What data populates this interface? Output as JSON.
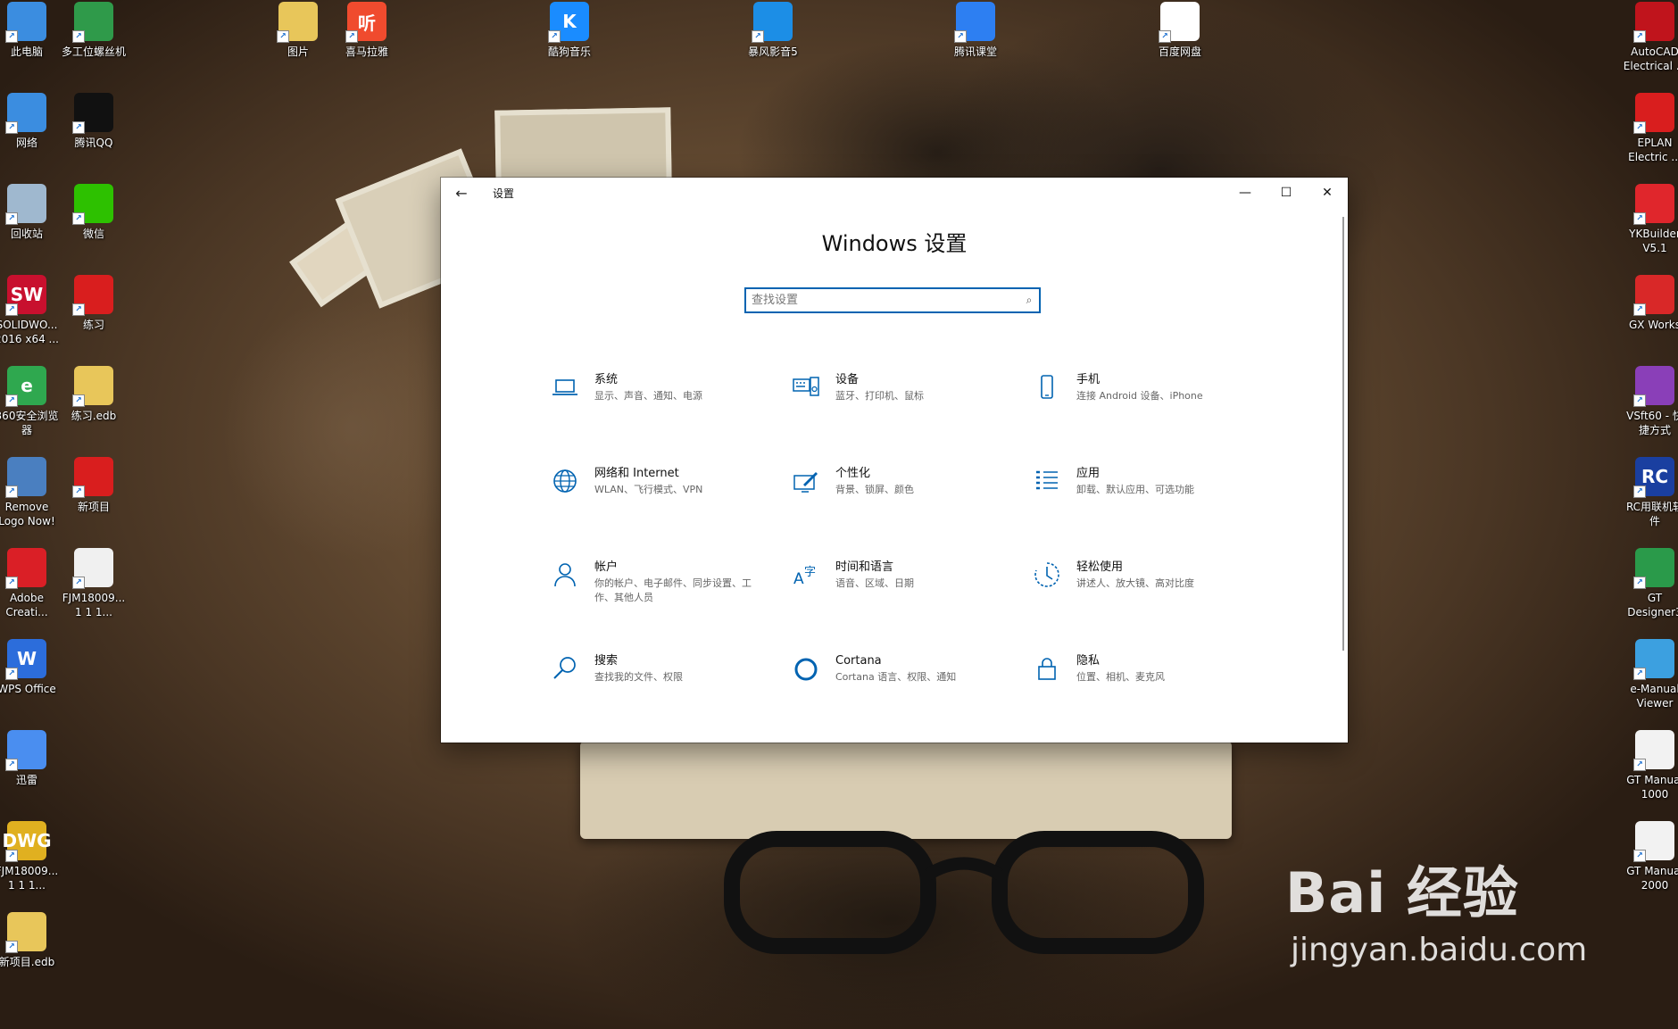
{
  "desktop": {
    "left_icons": [
      {
        "id": "this-pc",
        "label": "此电脑",
        "color": "#3b8de0"
      },
      {
        "id": "network",
        "label": "网络",
        "color": "#3b8de0"
      },
      {
        "id": "recycle-bin",
        "label": "回收站",
        "color": "#9fb8cf"
      },
      {
        "id": "solidworks",
        "label": "SOLIDWO...\n2016 x64 ...",
        "color": "#c8102e",
        "glyph": "SW"
      },
      {
        "id": "360-browser",
        "label": "360安全浏览\n器",
        "color": "#2fa84f",
        "glyph": "e"
      },
      {
        "id": "remove-logo",
        "label": "Remove\nLogo Now!",
        "color": "#4a7fc0"
      },
      {
        "id": "adobe-cc",
        "label": "Adobe\nCreati...",
        "color": "#da1f26"
      },
      {
        "id": "wps-office",
        "label": "WPS Office",
        "color": "#2c6ddb",
        "glyph": "W"
      },
      {
        "id": "xunlei",
        "label": "迅雷",
        "color": "#4a8ef0"
      },
      {
        "id": "dwg-file",
        "label": "FJM18009...\n1  1  1...",
        "color": "#e0b020",
        "glyph": "DWG"
      },
      {
        "id": "new-project-edb",
        "label": "新项目.edb",
        "color": "#e8c65a"
      }
    ],
    "second_icons": [
      {
        "id": "multi-screw",
        "label": "多工位螺丝机",
        "color": "#2f9a4a"
      },
      {
        "id": "tencent-qq",
        "label": "腾讯QQ",
        "color": "#111111"
      },
      {
        "id": "wechat",
        "label": "微信",
        "color": "#2dc100"
      },
      {
        "id": "practice",
        "label": "练习",
        "color": "#d91e1e"
      },
      {
        "id": "practice-edb",
        "label": "练习.edb",
        "color": "#e8c65a"
      },
      {
        "id": "new-project",
        "label": "新项目",
        "color": "#d91e1e"
      },
      {
        "id": "fjm-file",
        "label": "FJM18009...\n1  1  1...",
        "color": "#f0f0f0"
      }
    ],
    "top_icons": [
      {
        "id": "pictures",
        "label": "图片",
        "color": "#e8c65a"
      },
      {
        "id": "ximalaya",
        "label": "喜马拉雅",
        "color": "#f04b2e",
        "glyph": "听"
      },
      {
        "id": "kugou",
        "label": "酷狗音乐",
        "color": "#1a8cff",
        "glyph": "K"
      },
      {
        "id": "baofeng",
        "label": "暴风影音5",
        "color": "#1c8ee6"
      },
      {
        "id": "tencent-classroom",
        "label": "腾讯课堂",
        "color": "#2d7ff2"
      },
      {
        "id": "baidu-netdisk",
        "label": "百度网盘",
        "color": "#ffffff"
      }
    ],
    "right_icons": [
      {
        "id": "autocad-electrical",
        "label": "AutoCAD\nElectrical ...",
        "color": "#c0141c"
      },
      {
        "id": "eplan",
        "label": "EPLAN\nElectric ...",
        "color": "#d91e1e"
      },
      {
        "id": "ykbuilder",
        "label": "YKBuilder\nV5.1",
        "color": "#e0262c"
      },
      {
        "id": "gx-works",
        "label": "GX Works",
        "color": "#d92828"
      },
      {
        "id": "vsft60",
        "label": "VSft60 - 快\n捷方式",
        "color": "#8a3fb8"
      },
      {
        "id": "rc-networking",
        "label": "RC用联机软\n件",
        "color": "#1a3fa0",
        "glyph": "RC"
      },
      {
        "id": "gt-designer",
        "label": "GT\nDesigner3",
        "color": "#2a9a4a"
      },
      {
        "id": "e-manual-viewer",
        "label": "e-Manual\nViewer",
        "color": "#3ca0e0"
      },
      {
        "id": "gt-manual-1000",
        "label": "GT Manual\n1000",
        "color": "#f2f2f2"
      },
      {
        "id": "gt-manual-2000",
        "label": "GT Manual\n2000",
        "color": "#f2f2f2"
      }
    ]
  },
  "window": {
    "title": "设置",
    "back_glyph": "←",
    "min_glyph": "—",
    "max_glyph": "☐",
    "close_glyph": "✕",
    "heading": "Windows 设置",
    "search_placeholder": "查找设置",
    "accent": "#0063b1",
    "tiles": [
      {
        "id": "system",
        "icon": "laptop-icon",
        "name": "系统",
        "desc": "显示、声音、通知、电源"
      },
      {
        "id": "devices",
        "icon": "keyboard-speaker-icon",
        "name": "设备",
        "desc": "蓝牙、打印机、鼠标"
      },
      {
        "id": "phone",
        "icon": "phone-icon",
        "name": "手机",
        "desc": "连接 Android 设备、iPhone"
      },
      {
        "id": "network",
        "icon": "globe-icon",
        "name": "网络和 Internet",
        "desc": "WLAN、飞行模式、VPN"
      },
      {
        "id": "personalization",
        "icon": "paintbrush-screen-icon",
        "name": "个性化",
        "desc": "背景、锁屏、颜色"
      },
      {
        "id": "apps",
        "icon": "apps-list-icon",
        "name": "应用",
        "desc": "卸载、默认应用、可选功能"
      },
      {
        "id": "accounts",
        "icon": "person-icon",
        "name": "帐户",
        "desc": "你的帐户、电子邮件、同步设置、工作、其他人员"
      },
      {
        "id": "time-language",
        "icon": "language-icon",
        "name": "时间和语言",
        "desc": "语音、区域、日期"
      },
      {
        "id": "ease-of-access",
        "icon": "ease-access-icon",
        "name": "轻松使用",
        "desc": "讲述人、放大镜、高对比度"
      },
      {
        "id": "search",
        "icon": "search-icon",
        "name": "搜索",
        "desc": "查找我的文件、权限"
      },
      {
        "id": "cortana",
        "icon": "cortana-ring-icon",
        "name": "Cortana",
        "desc": "Cortana 语言、权限、通知"
      },
      {
        "id": "privacy",
        "icon": "lock-icon",
        "name": "隐私",
        "desc": "位置、相机、麦克风"
      }
    ]
  },
  "watermark": {
    "brand": "Bai 经验",
    "url": "jingyan.baidu.com"
  }
}
